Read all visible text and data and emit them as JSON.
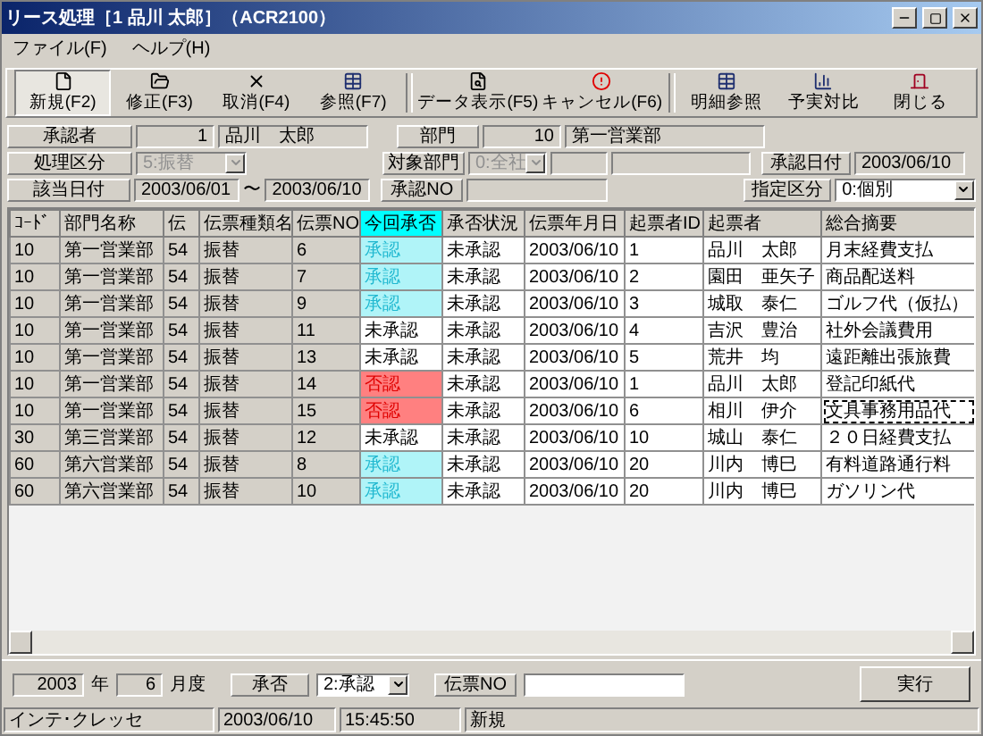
{
  "window": {
    "title": "リース処理［1 品川 太郎］（ACR2100）"
  },
  "menu": [
    "ファイル(F)",
    "ヘルプ(H)"
  ],
  "toolbar": [
    {
      "kind": "new",
      "label": "新規(F2)",
      "selected": true,
      "separator_before": false
    },
    {
      "kind": "open",
      "label": "修正(F3)",
      "selected": false,
      "separator_before": false
    },
    {
      "kind": "delete",
      "label": "取消(F4)",
      "selected": false,
      "separator_before": false
    },
    {
      "kind": "grid",
      "label": "参照(F7)",
      "selected": false,
      "separator_before": false
    },
    {
      "kind": "search",
      "label": "データ表示(F5)",
      "selected": false,
      "separator_before": true
    },
    {
      "kind": "cancel",
      "label": "キャンセル(F6)",
      "selected": false,
      "separator_before": false
    },
    {
      "kind": "grid",
      "label": "明細参照",
      "selected": false,
      "separator_before": true
    },
    {
      "kind": "compare",
      "label": "予実対比",
      "selected": false,
      "separator_before": false
    },
    {
      "kind": "exit",
      "label": "閉じる",
      "selected": false,
      "separator_before": false
    }
  ],
  "form": {
    "approver": {
      "label": "承認者",
      "code": "1",
      "name": "品川　太郎"
    },
    "department": {
      "label": "部門",
      "code": "10",
      "name": "第一営業部"
    },
    "process_type": {
      "label": "処理区分",
      "value": "5:振替",
      "disabled": true
    },
    "target_department": {
      "label": "対象部門",
      "value": "0:全社",
      "disabled": true
    },
    "approval_date": {
      "label": "承認日付",
      "value": "2003/06/10"
    },
    "period": {
      "label": "該当日付",
      "from": "2003/06/01",
      "separator": "〜",
      "to": "2003/06/10"
    },
    "approval_no": {
      "label": "承認NO"
    },
    "designation": {
      "label": "指定区分",
      "value": "0:個別"
    }
  },
  "table": {
    "columns": [
      "ｺｰﾄﾞ",
      "部門名称",
      "伝",
      "伝票種類名",
      "伝票NO",
      "今回承否",
      "承否状況",
      "伝票年月日",
      "起票者ID",
      "起票者",
      "総合摘要"
    ],
    "rows": [
      {
        "cells": [
          "10",
          "第一営業部",
          "54",
          "振替",
          "6",
          "承認",
          "未承認",
          "2003/06/10",
          "1",
          "品川　太郎",
          "月末経費支払"
        ],
        "kind": "approved",
        "focused": false
      },
      {
        "cells": [
          "10",
          "第一営業部",
          "54",
          "振替",
          "7",
          "承認",
          "未承認",
          "2003/06/10",
          "2",
          "園田　亜矢子",
          "商品配送料"
        ],
        "kind": "approved",
        "focused": false
      },
      {
        "cells": [
          "10",
          "第一営業部",
          "54",
          "振替",
          "9",
          "承認",
          "未承認",
          "2003/06/10",
          "3",
          "城取　泰仁",
          "ゴルフ代（仮払）"
        ],
        "kind": "approved",
        "focused": false
      },
      {
        "cells": [
          "10",
          "第一営業部",
          "54",
          "振替",
          "11",
          "未承認",
          "未承認",
          "2003/06/10",
          "4",
          "吉沢　豊治",
          "社外会議費用"
        ],
        "kind": "pending",
        "focused": false
      },
      {
        "cells": [
          "10",
          "第一営業部",
          "54",
          "振替",
          "13",
          "未承認",
          "未承認",
          "2003/06/10",
          "5",
          "荒井　均",
          "遠距離出張旅費"
        ],
        "kind": "pending",
        "focused": false
      },
      {
        "cells": [
          "10",
          "第一営業部",
          "54",
          "振替",
          "14",
          "否認",
          "未承認",
          "2003/06/10",
          "1",
          "品川　太郎",
          "登記印紙代"
        ],
        "kind": "rejected",
        "focused": false
      },
      {
        "cells": [
          "10",
          "第一営業部",
          "54",
          "振替",
          "15",
          "否認",
          "未承認",
          "2003/06/10",
          "6",
          "相川　伊介",
          "文具事務用品代"
        ],
        "kind": "rejected",
        "focused": true
      },
      {
        "cells": [
          "30",
          "第三営業部",
          "54",
          "振替",
          "12",
          "未承認",
          "未承認",
          "2003/06/10",
          "10",
          "城山　泰仁",
          "２０日経費支払"
        ],
        "kind": "pending",
        "focused": false
      },
      {
        "cells": [
          "60",
          "第六営業部",
          "54",
          "振替",
          "8",
          "承認",
          "未承認",
          "2003/06/10",
          "20",
          "川内　博巳",
          "有料道路通行料"
        ],
        "kind": "approved",
        "focused": false
      },
      {
        "cells": [
          "60",
          "第六営業部",
          "54",
          "振替",
          "10",
          "承認",
          "未承認",
          "2003/06/10",
          "20",
          "川内　博巳",
          "ガソリン代"
        ],
        "kind": "approved",
        "focused": false
      }
    ]
  },
  "bottom": {
    "year": "2003",
    "year_unit": "年",
    "month": "6",
    "month_unit": "月度",
    "approval_label": "承否",
    "approval_value": "2:承認",
    "slip_label": "伝票NO",
    "run_button": "実行"
  },
  "status_bar": [
    "インテ･クレッセ",
    "2003/06/10",
    "15:45:50",
    "新規"
  ]
}
